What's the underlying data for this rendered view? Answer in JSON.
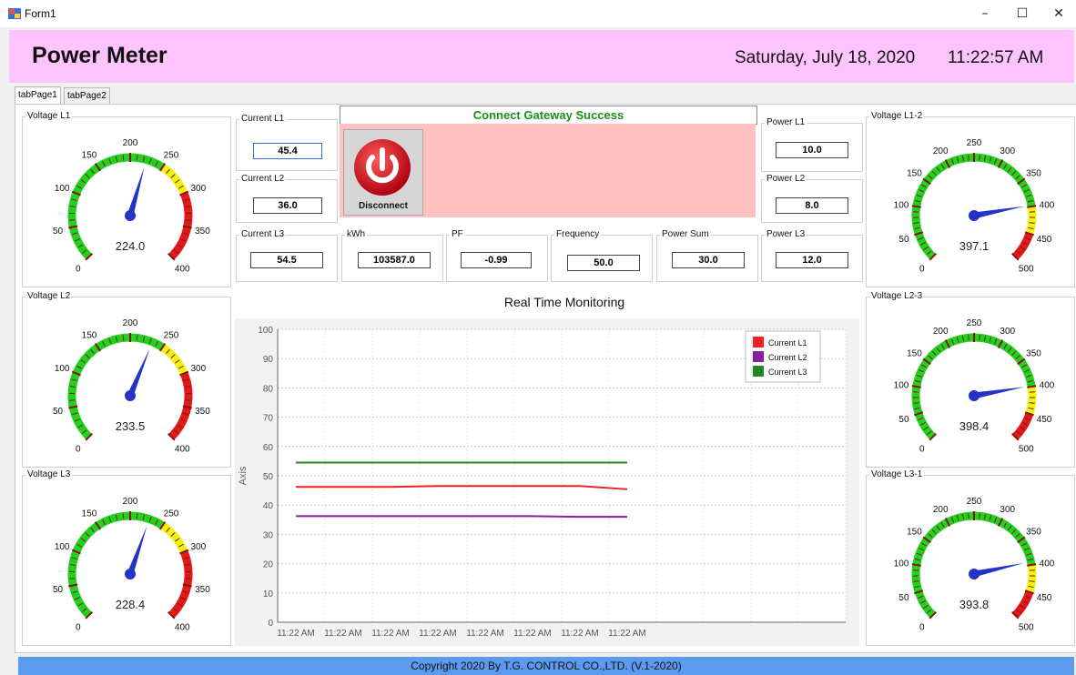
{
  "window": {
    "title": "Form1",
    "minimize": "–",
    "maximize": "☐",
    "close": "✕"
  },
  "header": {
    "title": "Power Meter",
    "date": "Saturday, July 18, 2020",
    "time": "11:22:57 AM"
  },
  "tabs": [
    {
      "label": "tabPage1",
      "active": true
    },
    {
      "label": "tabPage2",
      "active": false
    }
  ],
  "gauges": {
    "v_l1": {
      "title": "Voltage L1",
      "value": "224.0",
      "reading": 224.0,
      "labels": [
        "0",
        "50",
        "100",
        "150",
        "200",
        "250",
        "300",
        "350",
        "400"
      ],
      "max": 400
    },
    "v_l2": {
      "title": "Voltage L2",
      "value": "233.5",
      "reading": 233.5,
      "labels": [
        "0",
        "50",
        "100",
        "150",
        "200",
        "250",
        "300",
        "350",
        "400"
      ],
      "max": 400
    },
    "v_l3": {
      "title": "Voltage L3",
      "value": "228.4",
      "reading": 228.4,
      "labels": [
        "0",
        "50",
        "100",
        "150",
        "200",
        "250",
        "300",
        "350",
        "400"
      ],
      "max": 400
    },
    "v_l12": {
      "title": "Voltage L1-2",
      "value": "397.1",
      "reading": 397.1,
      "labels": [
        "0",
        "50",
        "100",
        "150",
        "200",
        "250",
        "300",
        "350",
        "400",
        "450",
        "500"
      ],
      "max": 500
    },
    "v_l23": {
      "title": "Voltage L2-3",
      "value": "398.4",
      "reading": 398.4,
      "labels": [
        "0",
        "50",
        "100",
        "150",
        "200",
        "250",
        "300",
        "350",
        "400",
        "450",
        "500"
      ],
      "max": 500
    },
    "v_l31": {
      "title": "Voltage L3-1",
      "value": "393.8",
      "reading": 393.8,
      "labels": [
        "0",
        "50",
        "100",
        "150",
        "200",
        "250",
        "300",
        "350",
        "400",
        "450",
        "500"
      ],
      "max": 500
    }
  },
  "readings": {
    "current_l1": {
      "title": "Current L1",
      "value": "45.4"
    },
    "current_l2": {
      "title": "Current L2",
      "value": "36.0"
    },
    "current_l3": {
      "title": "Current L3",
      "value": "54.5"
    },
    "kwh": {
      "title": "kWh",
      "value": "103587.0"
    },
    "pf": {
      "title": "PF",
      "value": "-0.99"
    },
    "frequency": {
      "title": "Frequency",
      "value": "50.0"
    },
    "power_sum": {
      "title": "Power Sum",
      "value": "30.0"
    },
    "power_l1": {
      "title": "Power L1",
      "value": "10.0"
    },
    "power_l2": {
      "title": "Power L2",
      "value": "8.0"
    },
    "power_l3": {
      "title": "Power L3",
      "value": "12.0"
    }
  },
  "status": {
    "message": "Connect Gateway Success",
    "disconnect_label": "Disconnect"
  },
  "chart_data": {
    "type": "line",
    "title": "Real Time Monitoring",
    "ylabel": "Axis",
    "xlabel": "",
    "ylim": [
      0,
      100
    ],
    "yticks": [
      0,
      10,
      20,
      30,
      40,
      50,
      60,
      70,
      80,
      90,
      100
    ],
    "x": [
      "11:22 AM",
      "11:22 AM",
      "11:22 AM",
      "11:22 AM",
      "11:22 AM",
      "11:22 AM",
      "11:22 AM",
      "11:22 AM"
    ],
    "legend_position": "top-right",
    "grid": true,
    "series": [
      {
        "name": "Current L1",
        "color": "#ee2020",
        "values": [
          46.2,
          46.2,
          46.2,
          46.5,
          46.5,
          46.5,
          46.5,
          45.4
        ]
      },
      {
        "name": "Current L2",
        "color": "#8a1fa0",
        "values": [
          36.2,
          36.2,
          36.2,
          36.2,
          36.2,
          36.2,
          36.0,
          36.0
        ]
      },
      {
        "name": "Current L3",
        "color": "#1f8a1f",
        "values": [
          54.5,
          54.5,
          54.5,
          54.5,
          54.5,
          54.5,
          54.5,
          54.5
        ]
      }
    ]
  },
  "footer": {
    "text": "Copyright 2020 By T.G. CONTROL CO.,LTD. (V.1-2020)"
  }
}
